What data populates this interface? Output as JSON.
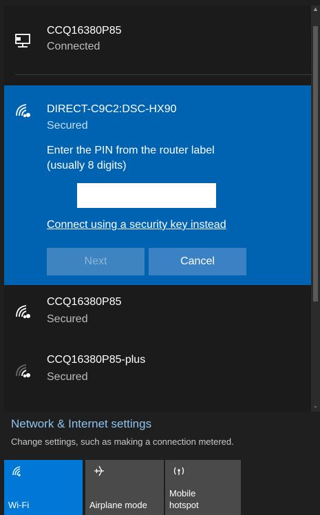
{
  "networks": {
    "wired": {
      "name": "CCQ16380P85",
      "status": "Connected",
      "icon": "ethernet-icon"
    },
    "expanded": {
      "name": "DIRECT-C9C2:DSC-HX90",
      "status": "Secured",
      "icon": "wifi-secured-icon",
      "prompt_line1": "Enter the PIN from the router label",
      "prompt_line2": "(usually 8 digits)",
      "pin_value": "",
      "alt_link": "Connect using a security key instead",
      "next_label": "Next",
      "cancel_label": "Cancel"
    },
    "items": [
      {
        "name": "CCQ16380P85",
        "status": "Secured",
        "icon": "wifi-secured-icon"
      },
      {
        "name": "CCQ16380P85-plus",
        "status": "Secured",
        "icon": "wifi-weak-secured-icon"
      }
    ]
  },
  "settings": {
    "title": "Network & Internet settings",
    "subtitle": "Change settings, such as making a connection metered."
  },
  "quick_actions": [
    {
      "label": "Wi-Fi",
      "icon": "wifi-icon",
      "active": true
    },
    {
      "label": "Airplane mode",
      "icon": "airplane-icon",
      "active": false
    },
    {
      "label_line1": "Mobile",
      "label_line2": "hotspot",
      "icon": "hotspot-icon",
      "active": false
    }
  ],
  "colors": {
    "accent": "#0063b1",
    "active_tile": "#0078d7",
    "link": "#8ec5f0",
    "background": "#1f1f1f"
  }
}
